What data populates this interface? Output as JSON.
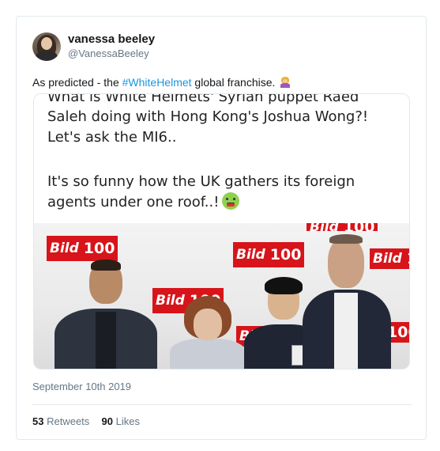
{
  "user": {
    "display_name": "vanessa beeley",
    "handle": "@VanessaBeeley"
  },
  "tweet": {
    "text_before": "As predicted - the ",
    "hashtag": "#WhiteHelmet",
    "text_after": " global franchise.",
    "date": "September 10th 2019"
  },
  "media": {
    "caption_lines": [
      "What is White Helmets' Syrian puppet Raed",
      "Saleh doing with Hong Kong's Joshua Wong?!",
      "Let's ask the MI6..",
      "It's so funny how the UK gathers its foreign",
      "agents under one roof..!"
    ],
    "logo_bild": "Bild",
    "logo_100": "100"
  },
  "stats": {
    "retweets_count": "53",
    "retweets_label": "Retweets",
    "likes_count": "90",
    "likes_label": "Likes"
  },
  "colors": {
    "link": "#1b95e0",
    "border": "#e1e8ed",
    "muted": "#657786",
    "bild_red": "#d7141a"
  }
}
